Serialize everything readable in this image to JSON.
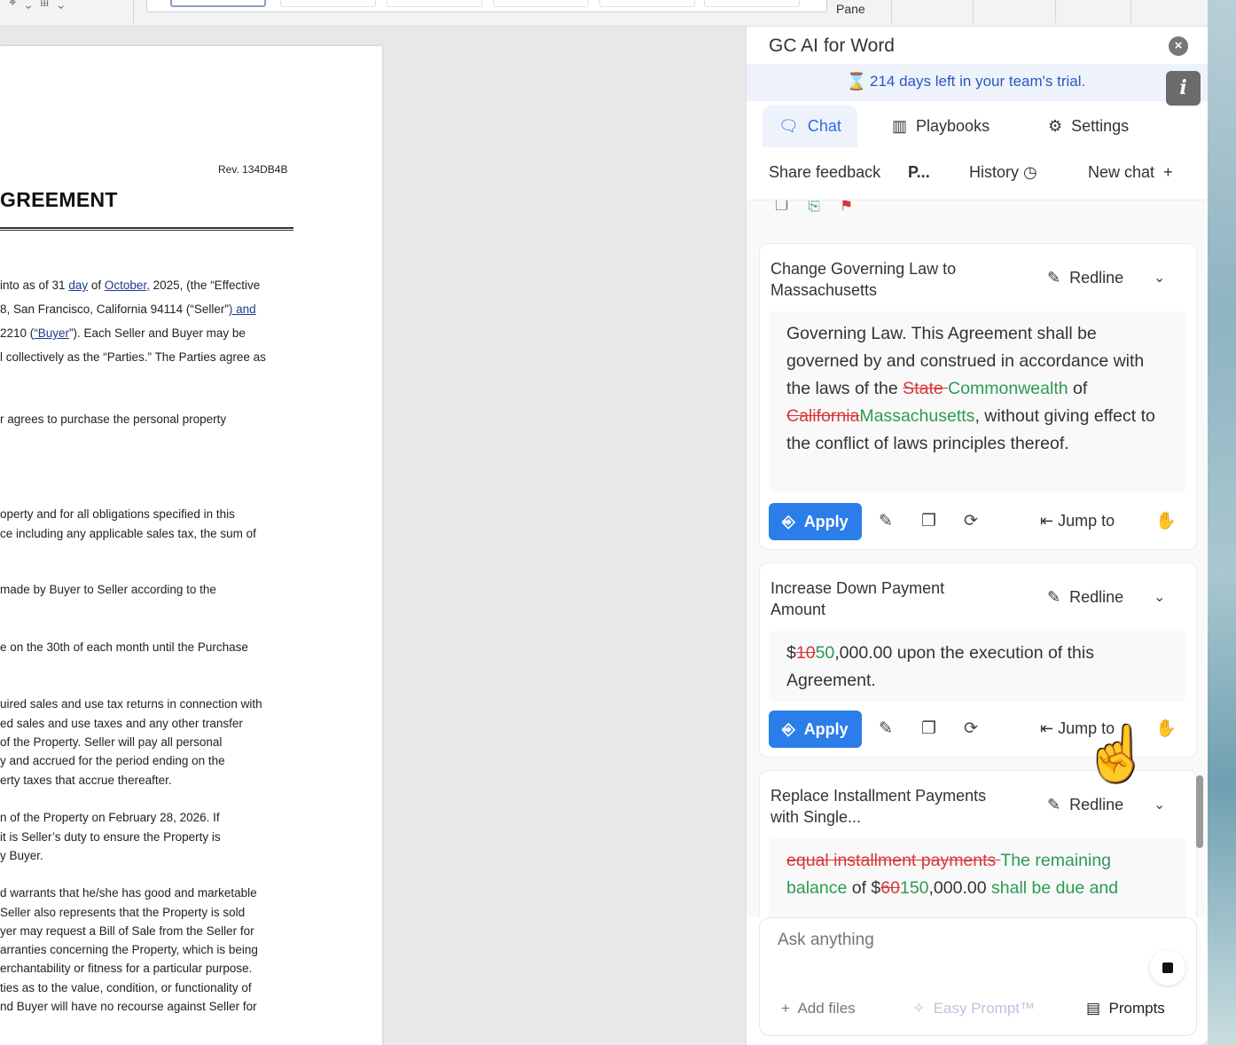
{
  "ribbon": {
    "pane_label": "Pane",
    "glyphs": "⌖⌄⊞⌄"
  },
  "document": {
    "rev": "Rev. 134DB4B",
    "title": "GREEMENT",
    "intro": [
      [
        "into as of 31 ",
        "day",
        " of ",
        "October,",
        " 2025, (the “Effective"
      ],
      [
        "8, San Francisco, California 94114 (“Seller”",
        ")  and",
        "",
        "",
        ""
      ],
      [
        "2210 (",
        "“Buyer",
        "”). Each Seller and Buyer may be",
        "",
        ""
      ],
      [
        "l collectively as the “Parties.” The Parties agree as",
        "",
        "",
        "",
        ""
      ]
    ],
    "lines": [
      "r agrees to purchase the personal property",
      "operty and for all obligations specified in this",
      "ce including any applicable sales tax, the sum of",
      "made by Buyer to Seller according to the",
      "e on the 30th of each month until the Purchase",
      "uired sales and use tax returns in connection with",
      "ed sales and use taxes and any other transfer",
      "of the Property. Seller will pay all personal",
      "y and accrued for the period ending on the",
      "erty taxes that accrue thereafter.",
      "n of the Property on February 28, 2026. If",
      "it is Seller’s duty to ensure the Property is",
      "y Buyer.",
      "d warrants that he/she has good and marketable",
      " Seller also represents that the Property is sold",
      "yer may request a Bill of Sale from the Seller for",
      "arranties concerning the Property, which is being",
      "erchantability or fitness for a particular purpose.",
      "ties as to the value, condition, or functionality of",
      "nd Buyer will have no recourse against Seller for"
    ]
  },
  "panel": {
    "title": "GC AI for Word",
    "trial_text": "214 days left in your team's trial.",
    "tabs": [
      {
        "label": "Chat",
        "icon": "chat-icon"
      },
      {
        "label": "Playbooks",
        "icon": "books-icon"
      },
      {
        "label": "Settings",
        "icon": "gear-icon"
      }
    ],
    "actions": {
      "feedback": "Share feedback",
      "p": "P...",
      "history": "History",
      "new_chat": "New chat"
    },
    "redline_label": "Redline",
    "apply_label": "Apply",
    "jump_label": "Jump to",
    "cards": [
      {
        "title": "Change Governing Law to Massachusetts",
        "body": [
          {
            "t": "Governing Law. This Agreement shall be governed by and construed in accordance with the laws of the ",
            "s": ""
          },
          {
            "t": "State ",
            "s": "del"
          },
          {
            "t": "Commonwealth",
            "s": "ins"
          },
          {
            "t": " of ",
            "s": ""
          },
          {
            "t": "California",
            "s": "del"
          },
          {
            "t": "Massachusetts",
            "s": "ins"
          },
          {
            "t": ", without giving effect to the conflict of laws principles thereof.",
            "s": ""
          }
        ]
      },
      {
        "title": "Increase Down Payment Amount",
        "body": [
          {
            "t": "$",
            "s": ""
          },
          {
            "t": "10",
            "s": "del"
          },
          {
            "t": "50",
            "s": "ins"
          },
          {
            "t": ",000.00 upon the execution of this Agreement.",
            "s": ""
          }
        ]
      },
      {
        "title": "Replace Installment Payments with Single...",
        "body": [
          {
            "t": "equal installment payments ",
            "s": "del"
          },
          {
            "t": "The remaining balance",
            "s": "ins"
          },
          {
            "t": " of $",
            "s": ""
          },
          {
            "t": "60",
            "s": "del"
          },
          {
            "t": "150",
            "s": "ins"
          },
          {
            "t": ",000.00 ",
            "s": ""
          },
          {
            "t": "shall be due and",
            "s": "ins"
          }
        ]
      }
    ],
    "composer": {
      "placeholder": "Ask anything",
      "add_files": "Add files",
      "easy_prompt": "Easy Prompt™",
      "prompts": "Prompts"
    }
  },
  "colors": {
    "accent": "#2b7de9",
    "deleted": "#d93636",
    "inserted": "#2d9a53",
    "trial_bg": "#eef3fb"
  }
}
